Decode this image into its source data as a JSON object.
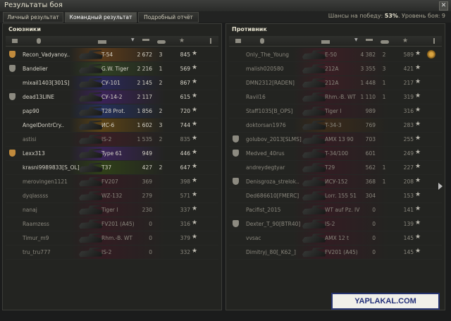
{
  "window": {
    "title": "Результаты боя",
    "close": "✕"
  },
  "tabs": [
    {
      "label": "Личный результат",
      "active": false
    },
    {
      "label": "Командный результат",
      "active": true
    },
    {
      "label": "Подробный отчёт",
      "active": false
    }
  ],
  "win_chance": {
    "label": "Шансы на победу:",
    "value": "53%",
    "level_text": "Уровень боя: 9"
  },
  "allies": {
    "title": "Союзники",
    "rows": [
      {
        "player": "Recon_Vadyanoy..",
        "tank": "T-54",
        "damage": "2 672",
        "kills": "3",
        "xp": "845",
        "badge": "gold",
        "color": "#5a3a1a",
        "dead": false
      },
      {
        "player": "Bandelier",
        "tank": "G.W. Tiger",
        "damage": "2 216",
        "kills": "1",
        "xp": "569",
        "badge": "gray",
        "color": "#2f3f22",
        "dead": false
      },
      {
        "player": "mixail1403[301S]",
        "tank": "СУ-101",
        "damage": "2 145",
        "kills": "2",
        "xp": "867",
        "badge": "",
        "color": "#2a2858",
        "dead": false
      },
      {
        "player": "dead13LINE",
        "tank": "СУ-14-2",
        "damage": "2 117",
        "kills": "",
        "xp": "615",
        "badge": "gray",
        "color": "#3a2258",
        "dead": false
      },
      {
        "player": "pap90",
        "tank": "T28 Prot.",
        "damage": "1 856",
        "kills": "2",
        "xp": "720",
        "badge": "",
        "color": "#25305a",
        "dead": false
      },
      {
        "player": "AngelDontrCry..",
        "tank": "ИС-6",
        "damage": "1 602",
        "kills": "3",
        "xp": "744",
        "badge": "",
        "color": "#5a4216",
        "dead": false
      },
      {
        "player": "astisi",
        "tank": "IS-2",
        "damage": "1 535",
        "kills": "2",
        "xp": "835",
        "badge": "",
        "color": "#3a1e24",
        "dead": true
      },
      {
        "player": "Lexx313",
        "tank": "Type 61",
        "damage": "949",
        "kills": "",
        "xp": "446",
        "badge": "gold",
        "color": "#3a2458",
        "dead": false
      },
      {
        "player": "krasni9989833[S_OL]",
        "tank": "T37",
        "damage": "427",
        "kills": "2",
        "xp": "647",
        "badge": "",
        "color": "#2f3f18",
        "dead": false
      },
      {
        "player": "merovingen1121",
        "tank": "FV207",
        "damage": "369",
        "kills": "",
        "xp": "398",
        "badge": "",
        "color": "#331c22",
        "dead": true
      },
      {
        "player": "dyqlassss",
        "tank": "WZ-132",
        "damage": "279",
        "kills": "",
        "xp": "571",
        "badge": "",
        "color": "#331c22",
        "dead": true
      },
      {
        "player": "nanaj",
        "tank": "Tiger I",
        "damage": "230",
        "kills": "",
        "xp": "337",
        "badge": "",
        "color": "#331c22",
        "dead": true
      },
      {
        "player": "Raamzess",
        "tank": "FV201 (A45)",
        "damage": "0",
        "kills": "",
        "xp": "316",
        "badge": "",
        "color": "#331c22",
        "dead": true
      },
      {
        "player": "Timur_m9",
        "tank": "Rhm.-B. WT",
        "damage": "0",
        "kills": "",
        "xp": "379",
        "badge": "",
        "color": "#331c22",
        "dead": true
      },
      {
        "player": "tru_tru777",
        "tank": "IS-2",
        "damage": "0",
        "kills": "",
        "xp": "332",
        "badge": "",
        "color": "#331c22",
        "dead": true
      }
    ]
  },
  "enemies": {
    "title": "Противник",
    "rows": [
      {
        "player": "Only_The_Young",
        "tank": "E-50",
        "damage": "4 382",
        "kills": "2",
        "xp": "589",
        "badge": "",
        "color": "#3a1e24",
        "dead": true,
        "medal": true
      },
      {
        "player": "malish020580",
        "tank": "212A",
        "damage": "3 355",
        "kills": "3",
        "xp": "421",
        "badge": "",
        "color": "#3a1e24",
        "dead": true
      },
      {
        "player": "DMN2312[RADEN]",
        "tank": "212A",
        "damage": "1 448",
        "kills": "1",
        "xp": "217",
        "badge": "",
        "color": "#3a1e24",
        "dead": true
      },
      {
        "player": "Ravil16",
        "tank": "Rhm.-B. WT",
        "damage": "1 110",
        "kills": "1",
        "xp": "319",
        "badge": "",
        "color": "#331c22",
        "dead": true
      },
      {
        "player": "Staff1035[B_OPS]",
        "tank": "Tiger I",
        "damage": "989",
        "kills": "",
        "xp": "316",
        "badge": "",
        "color": "#331c22",
        "dead": true
      },
      {
        "player": "doktorsan1976",
        "tank": "T-34-3",
        "damage": "769",
        "kills": "",
        "xp": "283",
        "badge": "",
        "color": "#3a2a1a",
        "dead": true
      },
      {
        "player": "golubov_2013[SLMS]",
        "tank": "AMX 13 90",
        "damage": "703",
        "kills": "",
        "xp": "255",
        "badge": "gray",
        "color": "#331c22",
        "dead": true
      },
      {
        "player": "Medved_40rus",
        "tank": "T-34/100",
        "damage": "601",
        "kills": "",
        "xp": "249",
        "badge": "gray",
        "color": "#331c22",
        "dead": true
      },
      {
        "player": "andreydegtyar",
        "tank": "T29",
        "damage": "562",
        "kills": "1",
        "xp": "227",
        "badge": "",
        "color": "#331c22",
        "dead": true
      },
      {
        "player": "Denisgroza_strelok..",
        "tank": "ИСУ-152",
        "damage": "368",
        "kills": "1",
        "xp": "208",
        "badge": "gray",
        "color": "#331c22",
        "dead": true
      },
      {
        "player": "Ded686610[FMERC]",
        "tank": "Lorr. 155 51",
        "damage": "304",
        "kills": "",
        "xp": "153",
        "badge": "",
        "color": "#331c22",
        "dead": true
      },
      {
        "player": "Pacifist_2015",
        "tank": "WT auf Pz. IV",
        "damage": "0",
        "kills": "",
        "xp": "141",
        "badge": "",
        "color": "#331c22",
        "dead": true
      },
      {
        "player": "Dexter_T_90[BTR40]",
        "tank": "IS-2",
        "damage": "0",
        "kills": "",
        "xp": "139",
        "badge": "gray",
        "color": "#331c22",
        "dead": true
      },
      {
        "player": "vvsac",
        "tank": "AMX 12 t",
        "damage": "0",
        "kills": "",
        "xp": "145",
        "badge": "",
        "color": "#331c22",
        "dead": true
      },
      {
        "player": "Dimitryj_80[_K62_]",
        "tank": "FV201 (A45)",
        "damage": "0",
        "kills": "",
        "xp": "145",
        "badge": "",
        "color": "#331c22",
        "dead": true
      }
    ]
  },
  "watermark": "YAPLAKAL.COM",
  "icons": {
    "star": "★",
    "sort": "▼"
  }
}
